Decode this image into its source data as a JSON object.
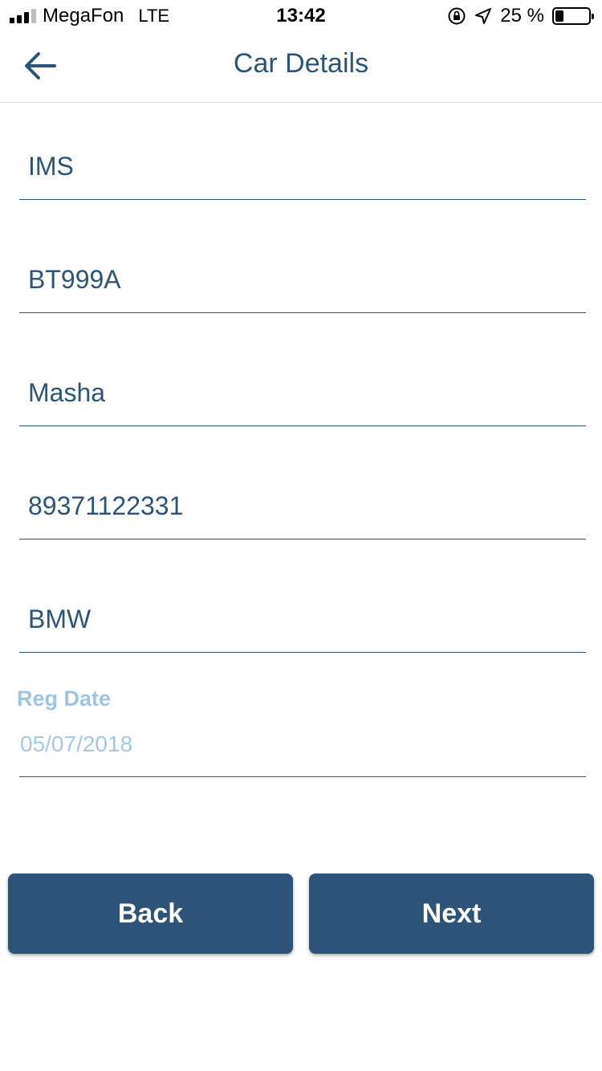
{
  "status_bar": {
    "carrier": "MegaFon",
    "network": "LTE",
    "time": "13:42",
    "battery_percent": "25 %",
    "battery_level": 0.25
  },
  "header": {
    "title": "Car Details",
    "back_icon": "arrow-left-icon"
  },
  "fields": [
    {
      "name": "company",
      "value": "IMS"
    },
    {
      "name": "plate",
      "value": "BT999A"
    },
    {
      "name": "owner",
      "value": "Masha"
    },
    {
      "name": "phone",
      "value": "89371122331"
    },
    {
      "name": "make",
      "value": "BMW"
    }
  ],
  "reg_date": {
    "label": "Reg Date",
    "value": "05/07/2018"
  },
  "buttons": {
    "back": "Back",
    "next": "Next"
  },
  "colors": {
    "accent": "#2d5478",
    "muted": "#9ec4e4"
  }
}
